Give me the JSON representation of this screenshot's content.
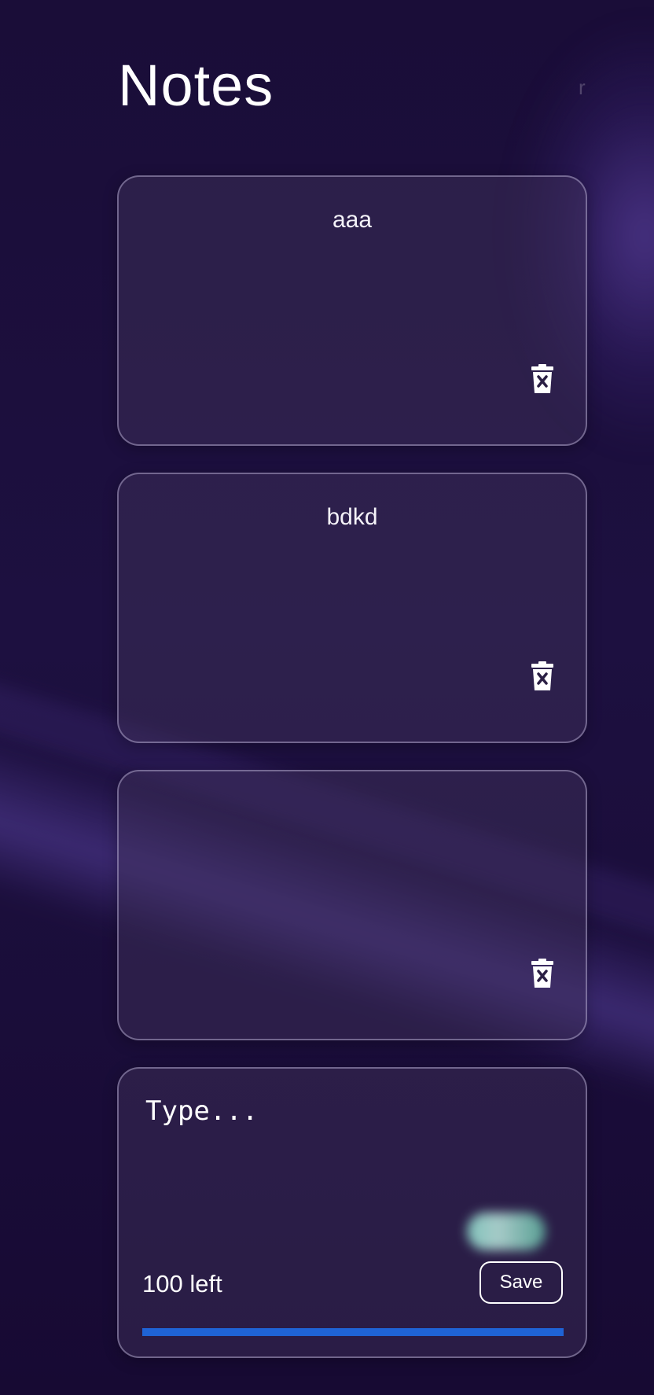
{
  "header": {
    "title": "Notes",
    "corner_text": "r"
  },
  "notes": [
    {
      "text": "aaa",
      "delete_icon": "trash-x-icon"
    },
    {
      "text": "bdkd",
      "delete_icon": "trash-x-icon"
    },
    {
      "text": "",
      "delete_icon": "trash-x-icon"
    }
  ],
  "composer": {
    "placeholder": "Type...",
    "value": "",
    "remaining_label": "100 left",
    "save_label": "Save",
    "progress_fraction": 1.0
  },
  "colors": {
    "background": "#170a33",
    "card": "#3a2d52",
    "progress": "#1f63d6",
    "text": "#ffffff"
  }
}
